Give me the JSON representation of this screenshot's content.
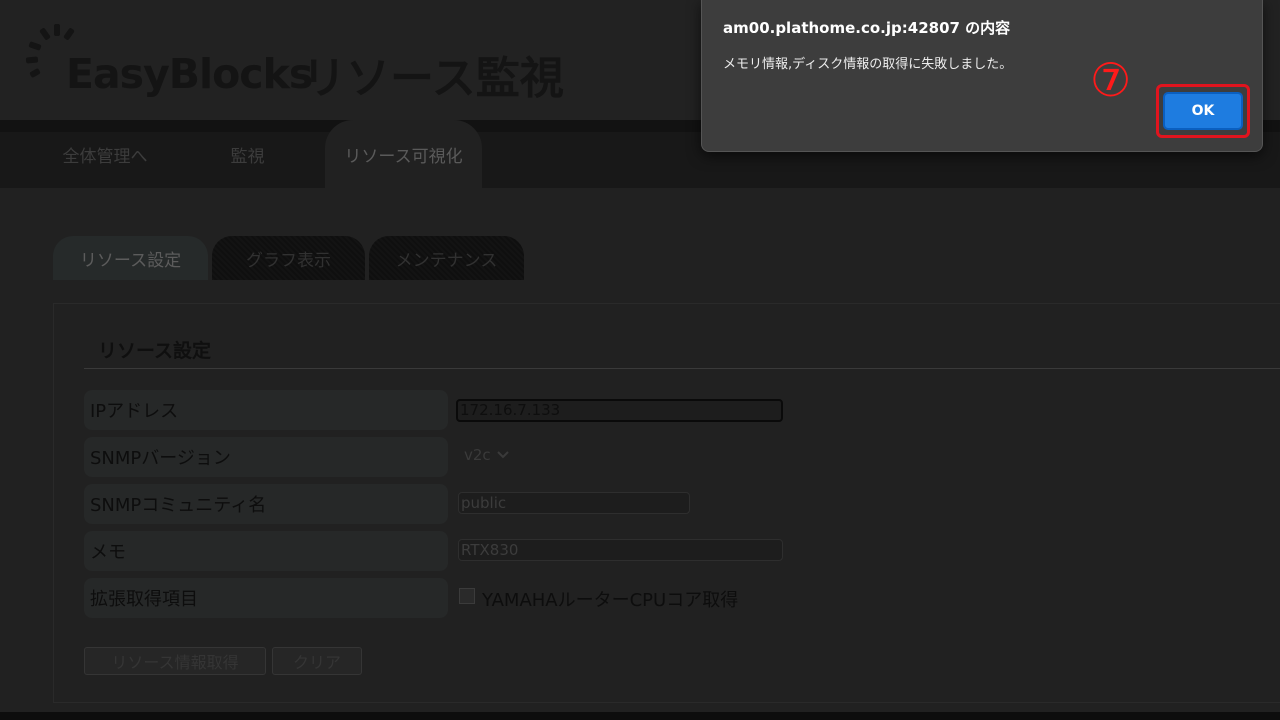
{
  "header": {
    "brand": "EasyBlocks",
    "title": "リソース監視"
  },
  "main_nav": {
    "tabs": [
      {
        "label": "全体管理へ"
      },
      {
        "label": "監視"
      },
      {
        "label": "リソース可視化"
      }
    ],
    "active_index": 2
  },
  "sub_nav": {
    "tabs": [
      {
        "label": "リソース設定"
      },
      {
        "label": "グラフ表示"
      },
      {
        "label": "メンテナンス"
      }
    ],
    "active_index": 0
  },
  "form": {
    "section_title": "リソース設定",
    "rows": [
      {
        "label": "IPアドレス",
        "value": "172.16.7.133"
      },
      {
        "label": "SNMPバージョン",
        "value": "v2c"
      },
      {
        "label": "SNMPコミュニティ名",
        "value": "public"
      },
      {
        "label": "メモ",
        "value": "RTX830"
      },
      {
        "label": "拡張取得項目",
        "value": "YAMAHAルーターCPUコア取得"
      }
    ],
    "buttons": {
      "fetch": "リソース情報取得",
      "clear": "クリア"
    }
  },
  "dialog": {
    "title": "am00.plathome.co.jp:42807 の内容",
    "message": "メモリ情報,ディスク情報の取得に失敗しました。",
    "ok_label": "OK",
    "step_marker": "⑦"
  },
  "colors": {
    "ok_button": "#1e7ce0",
    "highlight": "#e0141e",
    "step_marker": "#ff1a1a"
  }
}
